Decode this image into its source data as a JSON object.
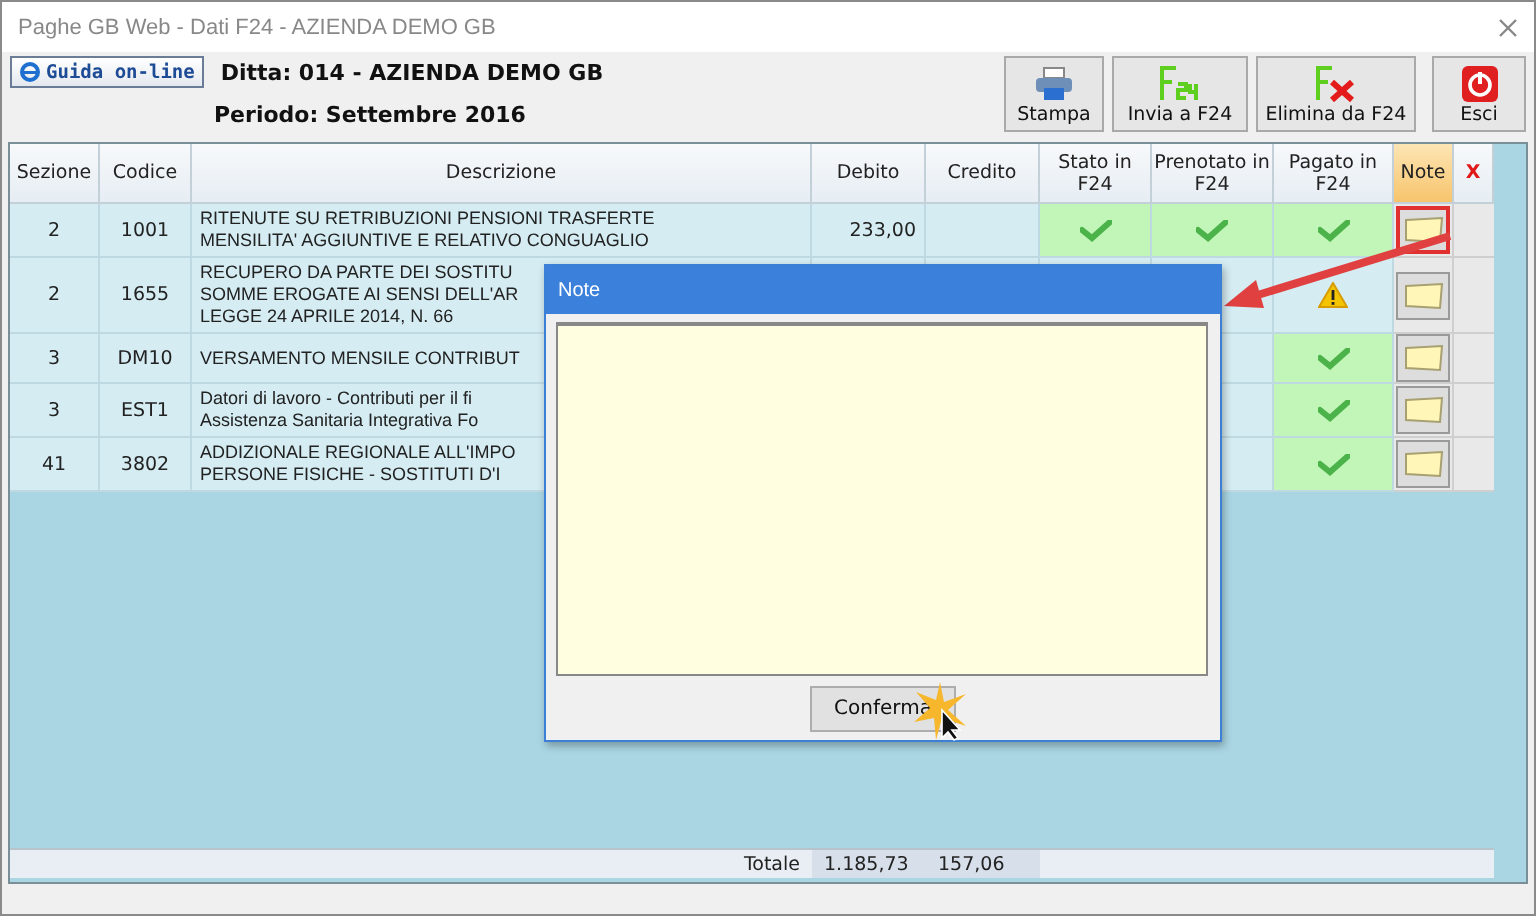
{
  "window": {
    "title": "Paghe GB Web - Dati F24 - AZIENDA DEMO GB"
  },
  "help_button": "Guida on-line",
  "company": "Ditta: 014 - AZIENDA DEMO GB",
  "period": "Periodo: Settembre 2016",
  "toolbar": [
    {
      "label": "Stampa",
      "kind": "print"
    },
    {
      "label": "Invia a F24",
      "kind": "send"
    },
    {
      "label": "Elimina da F24",
      "kind": "delete"
    },
    {
      "label": "Esci",
      "kind": "exit"
    }
  ],
  "table": {
    "columns": [
      "Sezione",
      "Codice",
      "Descrizione",
      "Debito",
      "Credito",
      "Stato in F24",
      "Prenotato in F24",
      "Pagato in F24",
      "Note",
      "X"
    ],
    "rows": [
      {
        "sezione": "2",
        "codice": "1001",
        "descrizione": [
          "RITENUTE SU RETRIBUZIONI  PENSIONI TRASFERTE",
          "MENSILITA' AGGIUNTIVE E RELATIVO CONGUAGLIO"
        ],
        "debito": "233,00",
        "stato": {
          "kind": "check"
        },
        "prenotato": {
          "kind": "check"
        },
        "pagato": {
          "kind": "check"
        },
        "note_highlighted": true
      },
      {
        "sezione": "2",
        "codice": "1655",
        "descrizione": [
          "RECUPERO DA PARTE DEI SOSTITU",
          "SOMME EROGATE AI SENSI DELL'AR",
          "LEGGE 24 APRILE 2014, N. 66"
        ],
        "pagato": {
          "kind": "warning"
        },
        "note_highlighted": false
      },
      {
        "sezione": "3",
        "codice": "DM10",
        "descrizione": [
          "VERSAMENTO MENSILE CONTRIBUT"
        ],
        "pagato": {
          "kind": "check"
        },
        "note_highlighted": false
      },
      {
        "sezione": "3",
        "codice": "EST1",
        "descrizione": [
          "Datori di lavoro - Contributi per il fi",
          "Assistenza Sanitaria Integrativa Fo"
        ],
        "pagato": {
          "kind": "check"
        },
        "note_highlighted": false
      },
      {
        "sezione": "41",
        "codice": "3802",
        "descrizione": [
          "ADDIZIONALE REGIONALE ALL'IMPO",
          "PERSONE FISICHE - SOSTITUTI D'I"
        ],
        "pagato": {
          "kind": "check"
        },
        "note_highlighted": false
      }
    ],
    "totals": {
      "label": "Totale",
      "debito": "1.185,73",
      "credito": "157,06"
    }
  },
  "dialog": {
    "title": "Note",
    "button": "Conferma"
  }
}
